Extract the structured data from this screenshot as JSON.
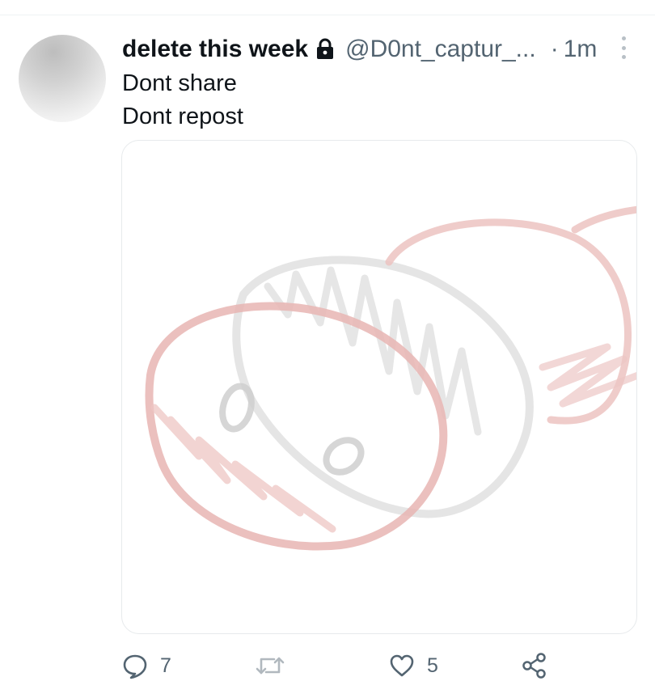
{
  "tweet": {
    "display_name": "delete this week",
    "handle": "@D0nt_captur_...",
    "separator": "·",
    "time": "1m",
    "text_lines": [
      "Dont share",
      "Dont repost"
    ],
    "protected_icon": "lock-icon",
    "media": {
      "description_icon": "drawing-image"
    },
    "actions": {
      "reply_count": "7",
      "repost_count": "",
      "like_count": "5"
    }
  },
  "icons": {
    "reply": "reply-icon",
    "repost": "repost-icon",
    "like": "heart-icon",
    "share": "share-icon",
    "more": "more-vertical-icon"
  },
  "colors": {
    "text_primary": "#0f1419",
    "text_secondary": "#536471",
    "sketch_red": "#e9b6b4",
    "sketch_gray": "#d7d7d7"
  }
}
